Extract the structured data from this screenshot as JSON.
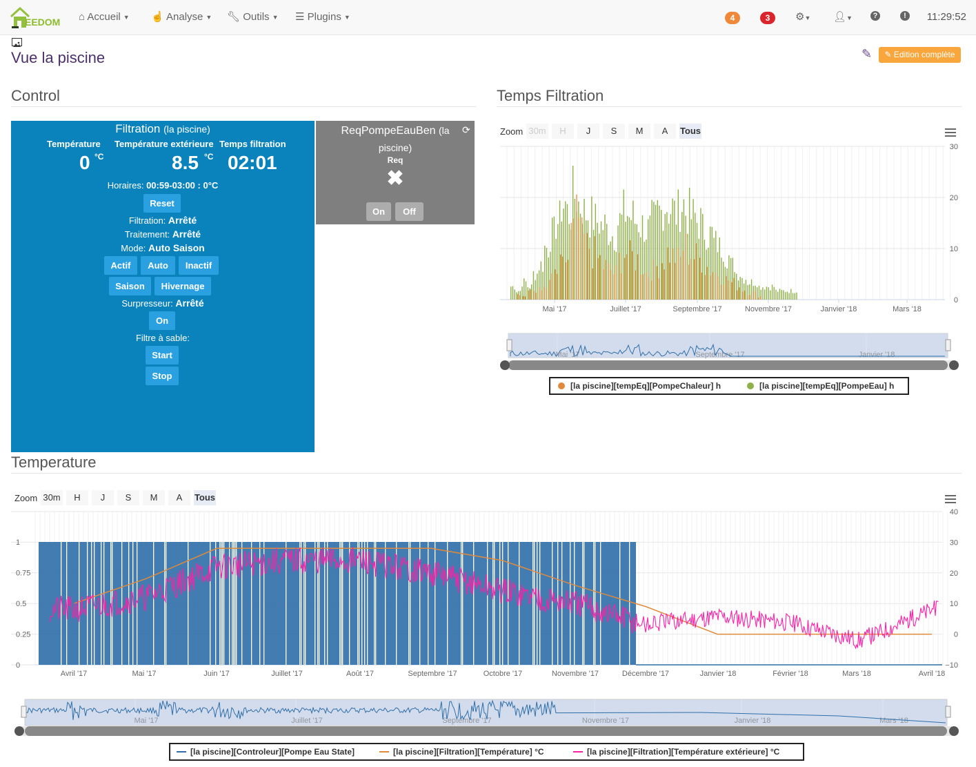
{
  "navbar": {
    "brand": "EEDOM",
    "menus": [
      {
        "label": "Accueil",
        "icon": "home-icon"
      },
      {
        "label": "Analyse",
        "icon": "hand-icon"
      },
      {
        "label": "Outils",
        "icon": "wrench-icon"
      },
      {
        "label": "Plugins",
        "icon": "tasks-icon"
      }
    ],
    "badges": [
      {
        "value": "4",
        "color": "#f0883a"
      },
      {
        "value": "3",
        "color": "#d9262c"
      }
    ],
    "clock": "11:29:52"
  },
  "page": {
    "title": "Vue la piscine",
    "edit_button": "Edition complète"
  },
  "control": {
    "title": "Control",
    "filtration": {
      "name": "Filtration",
      "object": "(la piscine)",
      "labels": {
        "temp": "Température",
        "ext": "Température extérieure",
        "time": "Temps filtration"
      },
      "values": {
        "temp": "0",
        "temp_unit": "°C",
        "ext": "8.5",
        "ext_unit": "°C",
        "time": "02:01"
      },
      "horaires_label": "Horaires:",
      "horaires_value": "00:59-03:00 : 0°C",
      "reset": "Reset",
      "filtration_label": "Filtration:",
      "filtration_value": "Arrêté",
      "traitement_label": "Traitement:",
      "traitement_value": "Arrêté",
      "mode_label": "Mode:",
      "mode_value": "Auto Saison",
      "mode_buttons": [
        "Actif",
        "Auto",
        "Inactif"
      ],
      "season_buttons": [
        "Saison",
        "Hivernage"
      ],
      "surpresseur_label": "Surpresseur:",
      "surpresseur_value": "Arrêté",
      "surpresseur_button": "On",
      "filtre_label": "Filtre à sable:",
      "start": "Start",
      "stop": "Stop"
    },
    "req": {
      "name": "ReqPompeEauBen",
      "object": "(la piscine)",
      "cmd": "Req",
      "on": "On",
      "off": "Off"
    }
  },
  "temps_filtration": {
    "title": "Temps Filtration",
    "zoom_label": "Zoom",
    "zoom_buttons": [
      "30m",
      "H",
      "J",
      "S",
      "M",
      "A",
      "Tous"
    ],
    "legend": [
      "[la piscine][tempEq][PompeChaleur] h",
      "[la piscine][tempEq][PompeEau] h"
    ],
    "navigator_labels": [
      "Mai '17",
      "Septembre '17",
      "Janvier '18"
    ],
    "colors": {
      "pompe_chaleur": "#e08a3c",
      "pompe_eau": "#8fb04a"
    },
    "chart_data": {
      "type": "bar",
      "title": "",
      "x_ticks": [
        "Mai '17",
        "Juillet '17",
        "Septembre '17",
        "Novembre '17",
        "Janvier '18",
        "Mars '18"
      ],
      "y_ticks": [
        "0",
        "10",
        "20",
        "30"
      ],
      "ylim": [
        0,
        30
      ],
      "grid": true,
      "legend_position": "bottom",
      "series": [
        {
          "name": "[la piscine][tempEq][PompeChaleur] h",
          "values": [
            2,
            1,
            3,
            2,
            4,
            3,
            6,
            8,
            10,
            12,
            20,
            24,
            18,
            16,
            14,
            12,
            10,
            9,
            8,
            12,
            14,
            13,
            12,
            10,
            8,
            9,
            10,
            12,
            14,
            13,
            12,
            16,
            14,
            13,
            12,
            10,
            9,
            8,
            7,
            6,
            5,
            4,
            3,
            2,
            2,
            1
          ]
        },
        {
          "name": "[la piscine][tempEq][PompeEau] h",
          "values": [
            3,
            2,
            4,
            3,
            6,
            8,
            12,
            15,
            18,
            22,
            20,
            24,
            22,
            20,
            19,
            18,
            17,
            16,
            15,
            18,
            20,
            19,
            18,
            17,
            16,
            18,
            20,
            22,
            21,
            20,
            22,
            20,
            19,
            18,
            16,
            15,
            13,
            12,
            10,
            8,
            6,
            5,
            4,
            4,
            3,
            3,
            3,
            2,
            2,
            2,
            2
          ]
        }
      ]
    }
  },
  "temperature": {
    "title": "Temperature",
    "zoom_label": "Zoom",
    "zoom_buttons": [
      "30m",
      "H",
      "J",
      "S",
      "M",
      "A",
      "Tous"
    ],
    "legend": [
      "[la piscine][Controleur][Pompe Eau State]",
      "[la piscine][Filtration][Température] °C",
      "[la piscine][Filtration][Température extérieure] °C"
    ],
    "navigator_labels": [
      "Mai '17",
      "Juillet '17",
      "Septembre '17",
      "Novembre '17",
      "Janvier '18",
      "Mars '18"
    ],
    "colors": {
      "state": "#2f6ea8",
      "temp": "#e08a3c",
      "ext": "#ff1fa5"
    },
    "chart_data": {
      "type": "line",
      "title": "",
      "x_ticks": [
        "Avril '17",
        "Mai '17",
        "Juin '17",
        "Juillet '17",
        "Août '17",
        "Septembre '17",
        "Octobre '17",
        "Novembre '17",
        "Décembre '17",
        "Janvier '18",
        "Février '18",
        "Mars '18",
        "Avril '18"
      ],
      "y_left_ticks": [
        "0",
        "0.25",
        "0.5",
        "0.75",
        "1"
      ],
      "y_right_ticks": [
        "−10",
        "0",
        "10",
        "20",
        "30",
        "40"
      ],
      "ylim_left": [
        0,
        1
      ],
      "ylim_right": [
        -10,
        40
      ],
      "grid": true,
      "legend_position": "bottom",
      "series": [
        {
          "name": "[la piscine][Controleur][Pompe Eau State]",
          "axis": "left",
          "x": [
            "Avril '17",
            "Décembre '17",
            "Avril '18"
          ],
          "y": [
            1,
            1,
            0
          ]
        },
        {
          "name": "[la piscine][Filtration][Température] °C",
          "axis": "right",
          "x": [
            "Avril '17",
            "Mai '17",
            "Juin '17",
            "Juillet '17",
            "Août '17",
            "Septembre '17",
            "Octobre '17",
            "Novembre '17",
            "Décembre '17",
            "Janvier '18",
            "Février '18",
            "Mars '18",
            "Avril '18"
          ],
          "y": [
            10,
            18,
            28,
            28,
            28,
            28,
            24,
            16,
            9,
            0,
            0,
            0,
            0
          ]
        },
        {
          "name": "[la piscine][Filtration][Température extérieure] °C",
          "axis": "right",
          "x": [
            "Avril '17",
            "Mai '17",
            "Juin '17",
            "Juillet '17",
            "Août '17",
            "Septembre '17",
            "Octobre '17",
            "Novembre '17",
            "Décembre '17",
            "Janvier '18",
            "Février '18",
            "Mars '18",
            "Avril '18"
          ],
          "y": [
            8,
            12,
            22,
            24,
            24,
            20,
            14,
            10,
            3,
            6,
            4,
            -2,
            8
          ]
        }
      ]
    }
  }
}
